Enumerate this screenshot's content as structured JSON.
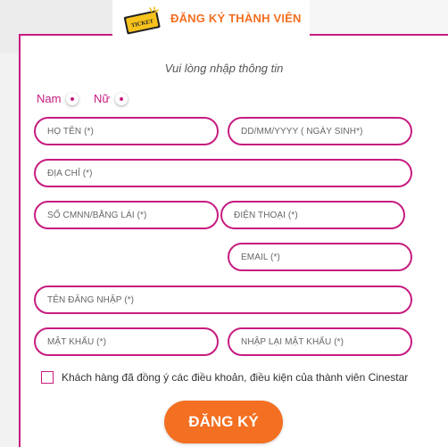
{
  "header": {
    "title": "ĐĂNG KÝ THÀNH VIÊN",
    "icon": "ticket-icon",
    "icon_text": "TICKET"
  },
  "form": {
    "subtitle": "Vui lòng nhập thông tin",
    "gender": {
      "male": "Nam",
      "female": "Nữ"
    },
    "fields": {
      "full_name": "HỌ TÊN (*)",
      "birthday": "DD/MM/YYYY ( NGÀY SINH*)",
      "address": "ĐỊA CHỈ (*)",
      "id_number": "SỐ CMNN/BẰNG LÁI (*)",
      "phone": "ĐIỆN THOẠI (*)",
      "email": "EMAIL (*)",
      "username": "TÊN ĐĂNG NHẬP (*)",
      "password": "MẬT KHẨU (*)",
      "confirm_password": "NHẬP LẠI MẬT KHẨU (*)"
    },
    "terms": "Khách hàng đã đồng ý các điều khoản, điều kiện của thành viên Cinestar",
    "submit": "ĐĂNG KÝ"
  },
  "colors": {
    "accent": "#c71c80",
    "button": "#f36f21"
  }
}
